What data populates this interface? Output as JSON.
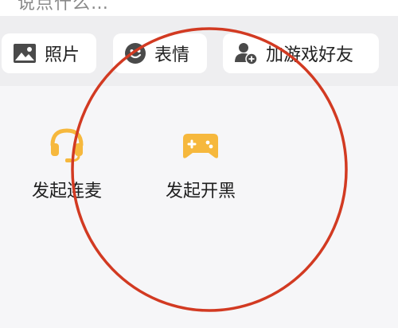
{
  "input": {
    "partial_text": "说点什么…"
  },
  "toolbar": {
    "chips": [
      {
        "label": "照片",
        "icon": "image-icon"
      },
      {
        "label": "表情",
        "icon": "emoji-icon"
      },
      {
        "label": "加游戏好友",
        "icon": "add-friend-icon"
      }
    ]
  },
  "actions": [
    {
      "label": "发起连麦",
      "icon": "headset-icon"
    },
    {
      "label": "发起开黑",
      "icon": "gamepad-icon"
    }
  ],
  "colors": {
    "icon_gray": "#4a4a4a",
    "icon_orange": "#f6b83d",
    "annotation_red": "#d23a22"
  }
}
